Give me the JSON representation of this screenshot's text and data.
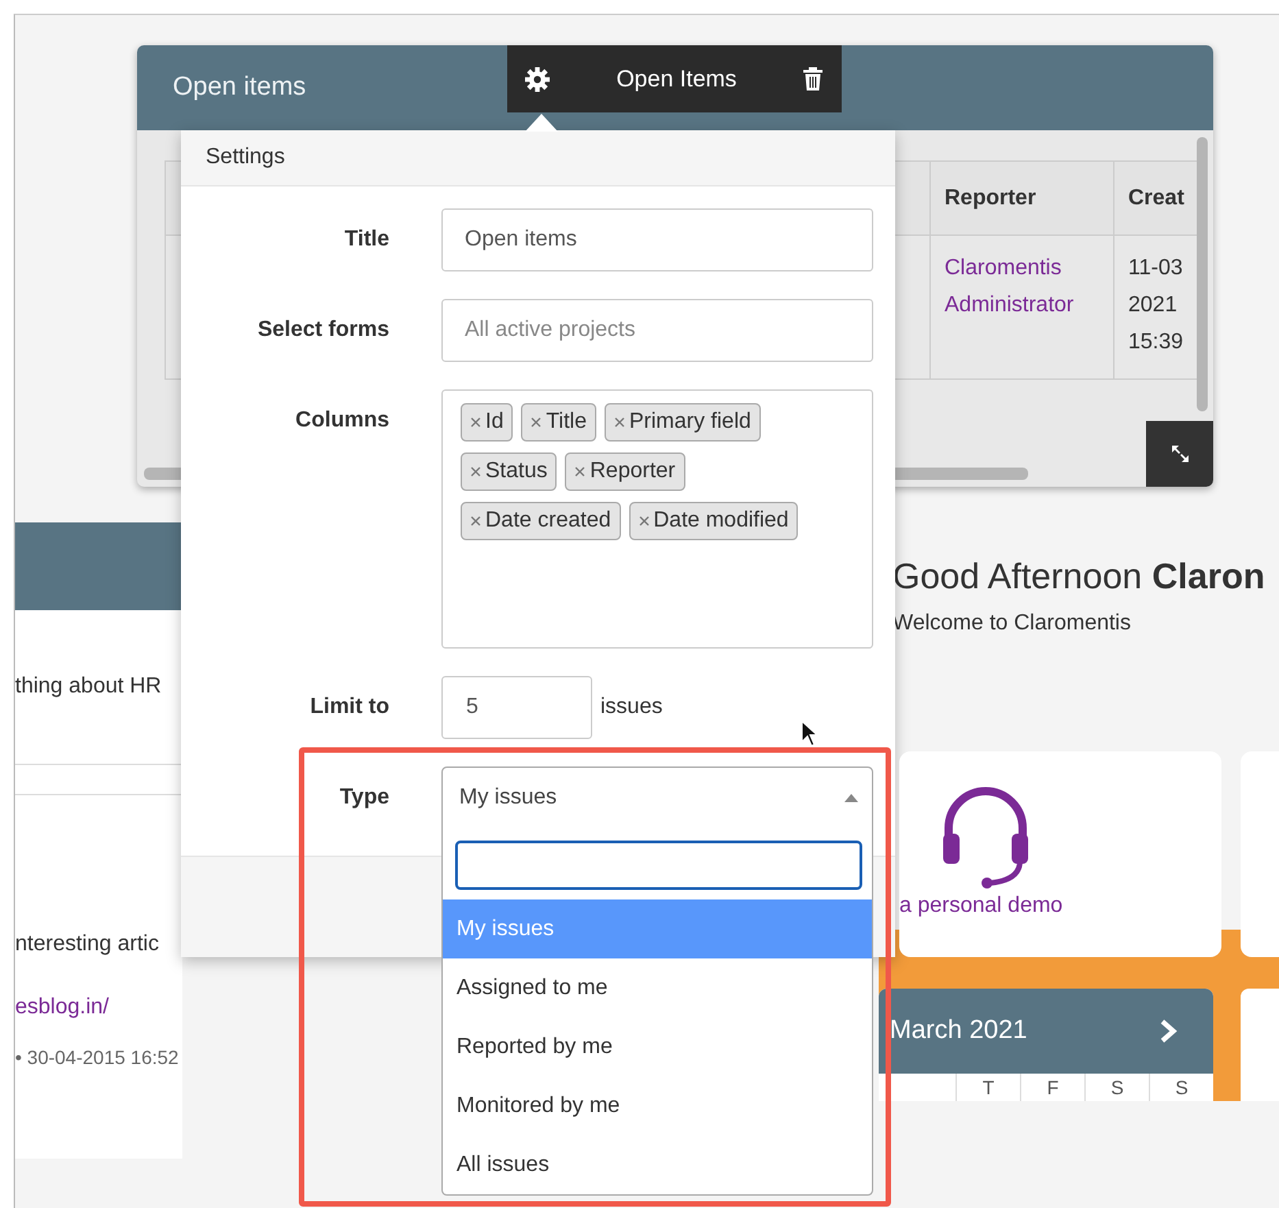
{
  "widget": {
    "title": "Open items",
    "table": {
      "columns": [
        "Reporter",
        "Creat"
      ],
      "rows": [
        {
          "reporter": "Claromentis Administrator",
          "created": [
            "11-03",
            "2021",
            "15:39"
          ]
        }
      ]
    }
  },
  "toolbar": {
    "title": "Open Items"
  },
  "settings": {
    "heading": "Settings",
    "fields": [
      {
        "kind": "text",
        "label": "Title",
        "value": "Open items"
      },
      {
        "kind": "text",
        "label": "Select forms",
        "placeholder": "All active projects"
      },
      {
        "kind": "tags",
        "label": "Columns",
        "tags": [
          "Id",
          "Title",
          "Primary field",
          "Status",
          "Reporter",
          "Date created",
          "Date modified"
        ]
      },
      {
        "kind": "number",
        "label": "Limit to",
        "value": "5",
        "suffix": "issues"
      },
      {
        "kind": "select",
        "label": "Type",
        "value": "My issues",
        "expanded": true
      }
    ]
  },
  "dropdown": {
    "options": [
      {
        "label": "My issues",
        "selected": true
      },
      {
        "label": "Assigned to me",
        "selected": false
      },
      {
        "label": "Reported by me",
        "selected": false
      },
      {
        "label": "Monitored by me",
        "selected": false
      },
      {
        "label": "All issues",
        "selected": false
      }
    ]
  },
  "background": {
    "left": {
      "snippets": [
        "thing about HR",
        "nteresting artic"
      ],
      "link": "esblog.in/",
      "meta": "• 30-04-2015 16:52"
    },
    "greeting": {
      "text": "Good Afternoon **Claron**",
      "sub": "Welcome to Claromentis"
    },
    "demo_card": {
      "label": "a personal demo"
    },
    "calendar": {
      "month": "March 2021",
      "weekdays": [
        "T",
        "F",
        "S",
        "S"
      ]
    }
  }
}
